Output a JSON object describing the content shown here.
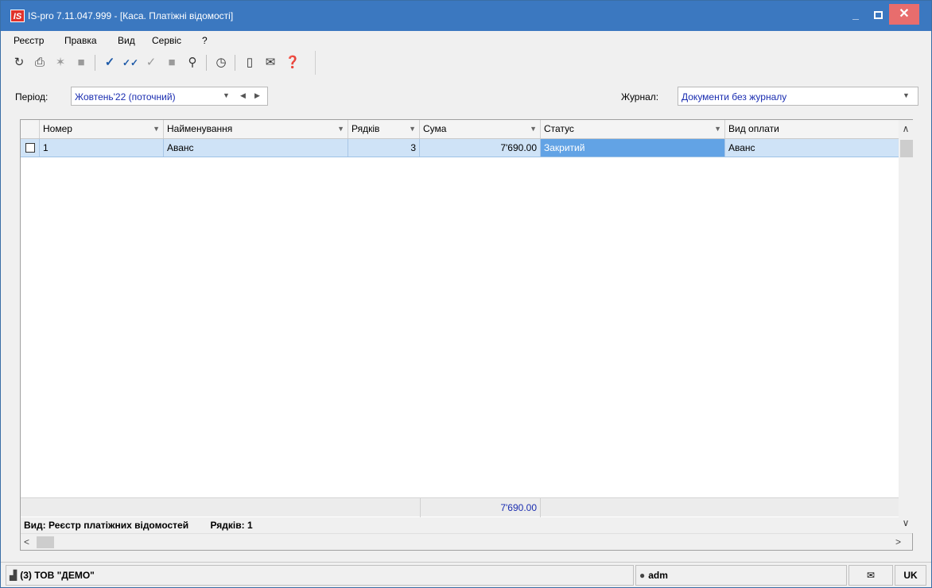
{
  "titlebar": {
    "logo": "IS",
    "title": "IS-pro 7.11.047.999 - [Каса. Платіжні відомості]",
    "minimize": "_",
    "close": "✕"
  },
  "menu": [
    "Реєстр",
    "Правка",
    "Вид",
    "Сервіс",
    "?"
  ],
  "toolbar": [
    {
      "name": "refresh-icon",
      "glyph": "↻"
    },
    {
      "name": "print-icon",
      "glyph": "⎙"
    },
    {
      "name": "new-document-icon",
      "glyph": "✶"
    },
    {
      "name": "copy-icon",
      "glyph": "■"
    },
    {
      "name": "check-icon",
      "glyph": "✓"
    },
    {
      "name": "check-all-icon",
      "glyph": "✓✓"
    },
    {
      "name": "uncheck-icon",
      "glyph": "✓"
    },
    {
      "name": "block-icon",
      "glyph": "■"
    },
    {
      "name": "search-icon",
      "glyph": "⚲"
    },
    {
      "name": "calendar-icon",
      "glyph": "◷"
    },
    {
      "name": "document-icon",
      "glyph": "▯"
    },
    {
      "name": "mail-icon",
      "glyph": "✉"
    },
    {
      "name": "help-icon",
      "glyph": "❓"
    }
  ],
  "filters": {
    "period_label": "Період:",
    "period_value": "Жовтень'22 (поточний)",
    "journal_label": "Журнал:",
    "journal_value": "Документи без журналу"
  },
  "grid": {
    "columns": [
      "Номер",
      "Найменування",
      "Рядків",
      "Сума",
      "Статус",
      "Вид оплати"
    ],
    "rows": [
      {
        "number": "1",
        "name": "Аванс",
        "rows": "3",
        "sum": "7'690.00",
        "status": "Закритий",
        "payment_type": "Аванс"
      }
    ],
    "total_sum": "7'690.00",
    "view_label": "Вид: Реєстр платіжних відомостей",
    "rows_count_label": "Рядків: 1"
  },
  "statusbar": {
    "company": "(3) ТОВ \"ДЕМО\"",
    "user": "adm",
    "language": "UK"
  }
}
